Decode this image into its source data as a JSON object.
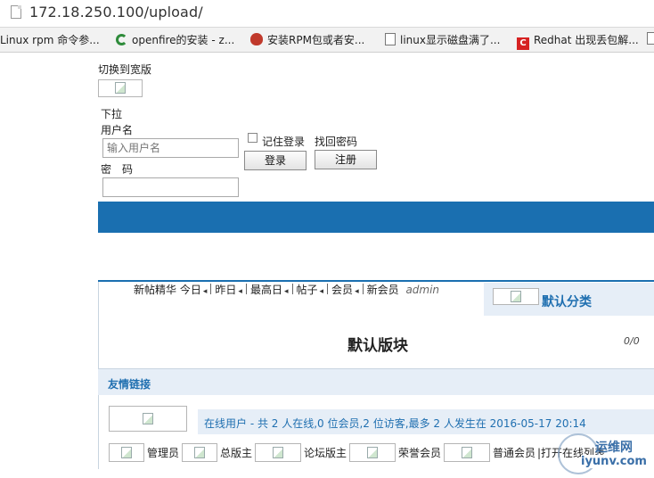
{
  "browser": {
    "url": "172.18.250.100/upload/",
    "bookmarks": [
      {
        "label": "Linux rpm 命令参...",
        "icon": "doc-icon"
      },
      {
        "label": "openfire的安装 - z...",
        "icon": "c-icon"
      },
      {
        "label": "安装RPM包或者安...",
        "icon": "redhat-icon"
      },
      {
        "label": "linux显示磁盘满了...",
        "icon": "doc-icon"
      },
      {
        "label": "Redhat 出现丢包解...",
        "icon": "c-red-icon"
      }
    ]
  },
  "header": {
    "switch_wide": "切换到宽版",
    "dropdown": "下拉",
    "username_label": "用户名",
    "username_placeholder": "输入用户名",
    "password_label": "密　码",
    "remember_label": "记住登录",
    "forgot_link": "找回密码",
    "login_button": "登录",
    "register_button": "注册"
  },
  "stats": {
    "items": [
      "新帖",
      "精华",
      "今日",
      "昨日",
      "最高日",
      "帖子",
      "会员",
      "新会员"
    ],
    "newest_member": "admin"
  },
  "category": {
    "title": "默认分类"
  },
  "forum": {
    "name": "默认版块",
    "counts": "0/0"
  },
  "links": {
    "title": "友情链接"
  },
  "online": {
    "summary": "在线用户 - 共 2 人在线,0 位会员,2 位访客,最多 2 人发生在 2016-05-17 20:14",
    "roles": [
      "管理员",
      "总版主",
      "论坛版主",
      "荣誉会员",
      "普通会员"
    ],
    "expand_link": "打开在线列表"
  },
  "watermark": {
    "text": "iyunv.com",
    "cn": "运维网"
  },
  "colors": {
    "nav_bar": "#1a6fb0",
    "link_blue": "#1f6fb0",
    "panel_bg": "#e6eef7"
  }
}
